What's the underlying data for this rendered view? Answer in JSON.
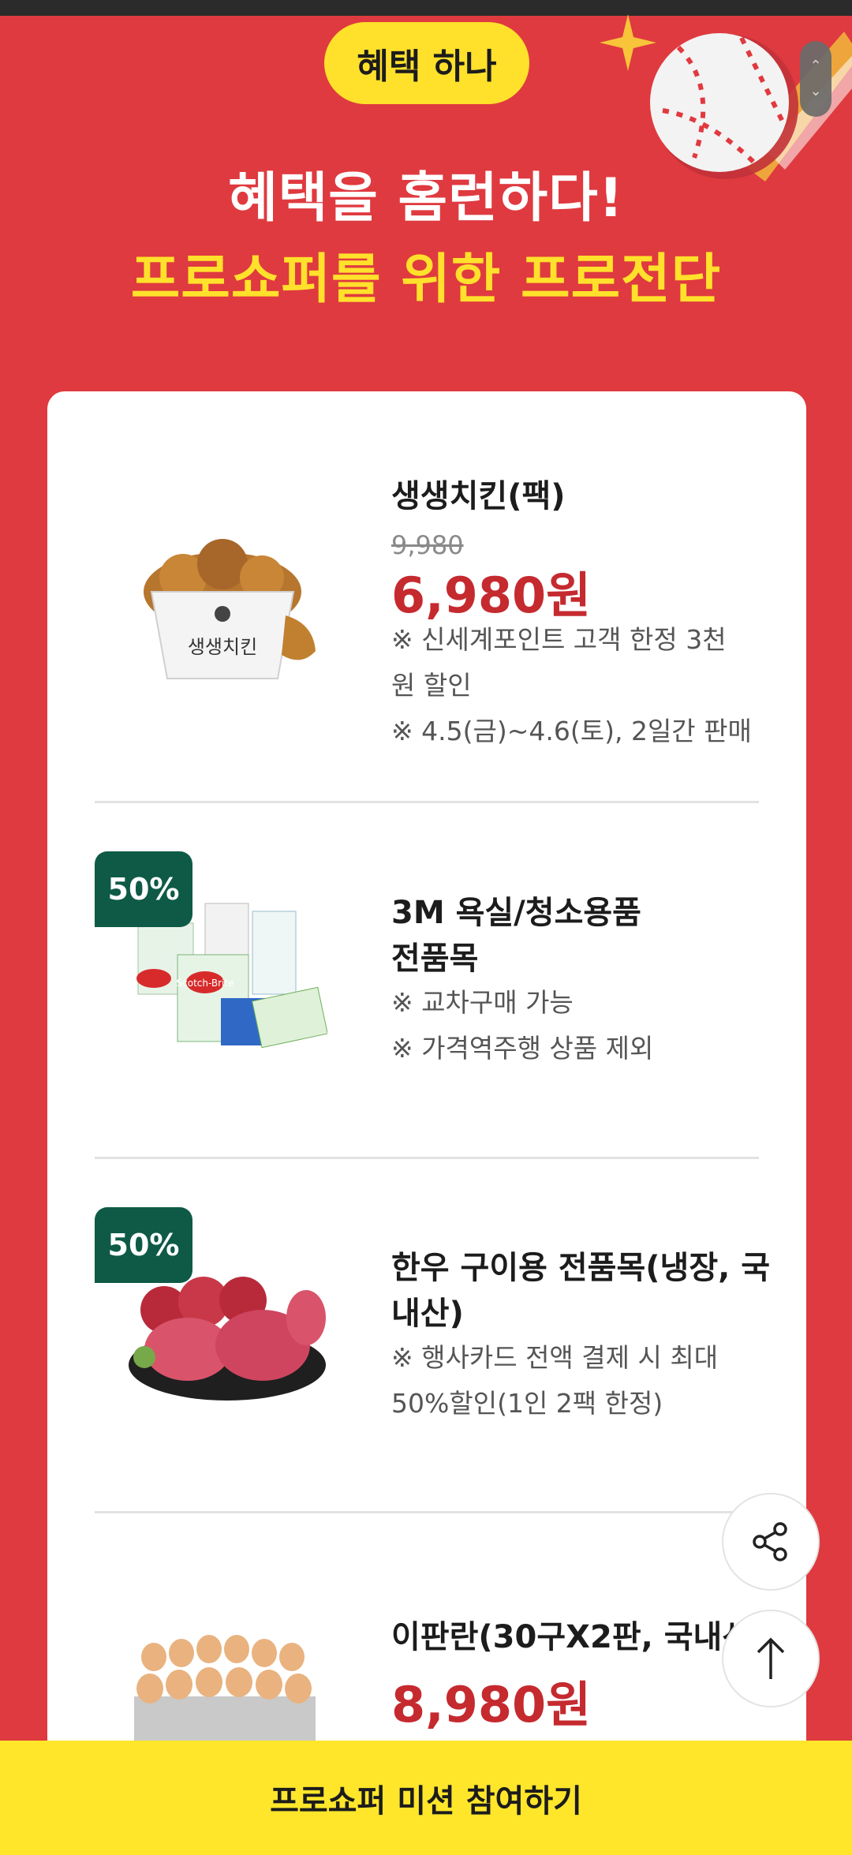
{
  "hero": {
    "pill_label": "혜택 하나",
    "title": "혜택을 홈런하다!",
    "subtitle": "프로쇼퍼를 위한 프로전단"
  },
  "products": [
    {
      "name": "생생치킨(팩)",
      "original_price": "9,980",
      "price": "6,980원",
      "notes": [
        "※ 신세계포인트 고객 한정 3천",
        "원 할인",
        "※ 4.5(금)~4.6(토), 2일간 판매"
      ],
      "image_label": "생생치킨"
    },
    {
      "badge": "50%",
      "name_lines": [
        "3M 욕실/청소용품",
        "전품목"
      ],
      "notes": [
        "※ 교차구매 가능",
        "※ 가격역주행 상품 제외"
      ],
      "image_label": "Scotch-Brite"
    },
    {
      "badge": "50%",
      "name_lines": [
        "한우 구이용 전품목(냉장, 국",
        "내산)"
      ],
      "notes": [
        "※ 행사카드 전액 결제 시 최대",
        "50%할인(1인 2팩 한정)"
      ]
    },
    {
      "name": "이판란(30구X2판, 국내산)",
      "price": "8,980원"
    }
  ],
  "fab": {
    "share_icon": "share-icon",
    "top_icon": "arrow-up-icon"
  },
  "bottom_cta": "프로쇼퍼 미션 참여하기",
  "colors": {
    "background": "#df3a3f",
    "accent_yellow": "#ffe12b",
    "price_red": "#c52a2f",
    "badge_green": "#0e5a46"
  }
}
